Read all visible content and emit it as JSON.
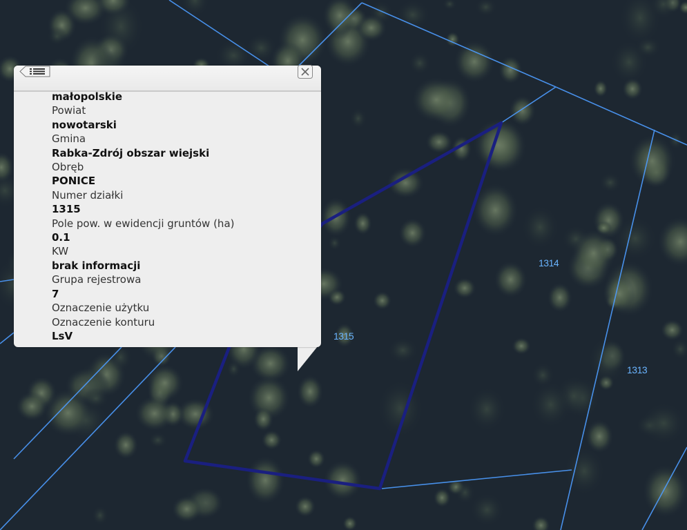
{
  "map": {
    "colors": {
      "background": "#1b2530",
      "parcel_line": "#4d9cff",
      "selected_parcel": "#1a1f80",
      "label": "#6ab4ff"
    },
    "plot_labels": [
      "1314",
      "1315",
      "1313"
    ]
  },
  "popup": {
    "back_icon": "list-back-icon",
    "close_icon": "close-icon",
    "attributes": [
      {
        "type": "value",
        "text": "małopolskie"
      },
      {
        "type": "label",
        "text": "Powiat"
      },
      {
        "type": "value",
        "text": "nowotarski"
      },
      {
        "type": "label",
        "text": "Gmina"
      },
      {
        "type": "value",
        "text": "Rabka-Zdrój obszar wiejski"
      },
      {
        "type": "label",
        "text": "Obręb"
      },
      {
        "type": "value",
        "text": "PONICE"
      },
      {
        "type": "label",
        "text": "Numer działki"
      },
      {
        "type": "value",
        "text": "1315"
      },
      {
        "type": "label",
        "text": "Pole pow. w ewidencji gruntów (ha)"
      },
      {
        "type": "value",
        "text": "0.1"
      },
      {
        "type": "label",
        "text": "KW"
      },
      {
        "type": "value",
        "text": "brak informacji"
      },
      {
        "type": "label",
        "text": "Grupa rejestrowa"
      },
      {
        "type": "value",
        "text": "7"
      },
      {
        "type": "label",
        "text": "Oznaczenie użytku"
      },
      {
        "type": "label",
        "text": "Oznaczenie konturu"
      },
      {
        "type": "value",
        "text": "LsV"
      }
    ]
  }
}
